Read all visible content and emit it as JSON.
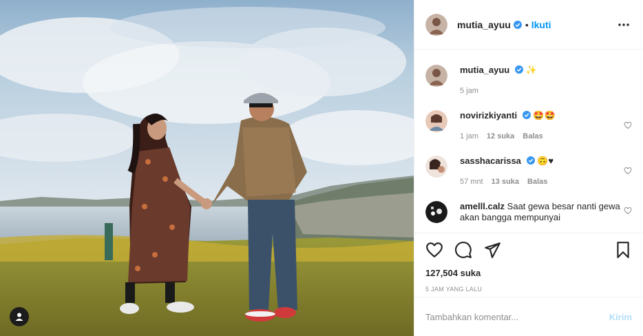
{
  "post": {
    "username": "mutia_ayuu",
    "follow_label": "Ikuti",
    "separator": "•",
    "more_icon": "more-horizontal-icon",
    "verified_color": "#3897f0",
    "accent_color": "#0095f6"
  },
  "caption": {
    "username": "mutia_ayuu",
    "text": "✨",
    "time": "5 jam"
  },
  "comments": [
    {
      "username": "novirizkiyanti",
      "text": "🤩🤩",
      "time": "1 jam",
      "likes": "12 suka",
      "reply": "Balas",
      "verified": true
    },
    {
      "username": "sasshacarissa",
      "text": "🙃♥",
      "time": "57 mnt",
      "likes": "13 suka",
      "reply": "Balas",
      "verified": true
    },
    {
      "username": "amelll.calz",
      "text": "Saat gewa besar nanti gewa akan bangga mempunyai",
      "verified": false
    }
  ],
  "actions": {
    "likes": "127,504 suka",
    "timestamp": "5 JAM YANG LALU",
    "icons": [
      "heart-icon",
      "comment-icon",
      "share-icon",
      "bookmark-icon"
    ]
  },
  "add_comment": {
    "placeholder": "Tambahkan komentar...",
    "post_label": "Kirim"
  }
}
